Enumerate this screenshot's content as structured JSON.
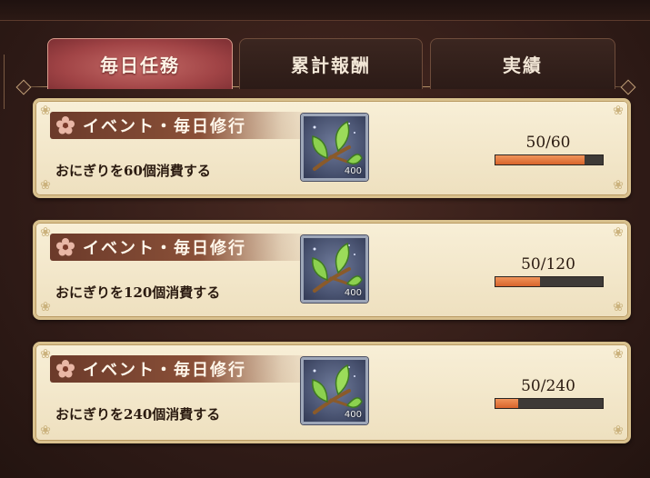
{
  "tabs": [
    {
      "label": "毎日任務",
      "active": true
    },
    {
      "label": "累計報酬",
      "active": false
    },
    {
      "label": "実績",
      "active": false
    }
  ],
  "missions": [
    {
      "title": "イベント・毎日修行",
      "description": "おにぎりを60個消費する",
      "reward_icon": "leaf-branch-icon",
      "reward_count": "400",
      "progress_text": "50/60",
      "progress_fraction": 0.8333
    },
    {
      "title": "イベント・毎日修行",
      "description": "おにぎりを120個消費する",
      "reward_icon": "leaf-branch-icon",
      "reward_count": "400",
      "progress_text": "50/120",
      "progress_fraction": 0.4167
    },
    {
      "title": "イベント・毎日修行",
      "description": "おにぎりを240個消費する",
      "reward_icon": "leaf-branch-icon",
      "reward_count": "400",
      "progress_text": "50/240",
      "progress_fraction": 0.2083
    }
  ],
  "colors": {
    "active_tab": "#a14446",
    "card_bg": "#f5ead0",
    "progress_fill": "#e0703a",
    "progress_track": "#3e3a37"
  }
}
